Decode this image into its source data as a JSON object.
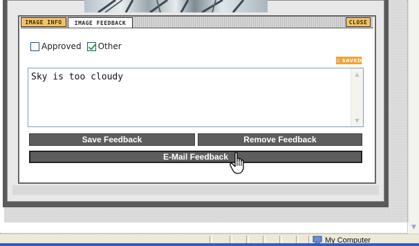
{
  "tabs": {
    "image_info": "IMAGE INFO",
    "image_feedback": "IMAGE FEEDBACK",
    "close": "CLOSE"
  },
  "checkboxes": [
    {
      "label": "Approved",
      "checked": false
    },
    {
      "label": "Other",
      "checked": true
    }
  ],
  "status_badge": "SAVED",
  "feedback": {
    "text": "Sky is too cloudy"
  },
  "buttons": {
    "save": "Save Feedback",
    "remove": "Remove Feedback",
    "email": "E-Mail Feedback"
  },
  "status_bar": {
    "zone": "My Computer"
  },
  "colors": {
    "tab_accent": "#f3c267",
    "saved_badge": "#f0a234",
    "button_bg": "#5d5d5d",
    "check_green": "#22aa22"
  }
}
